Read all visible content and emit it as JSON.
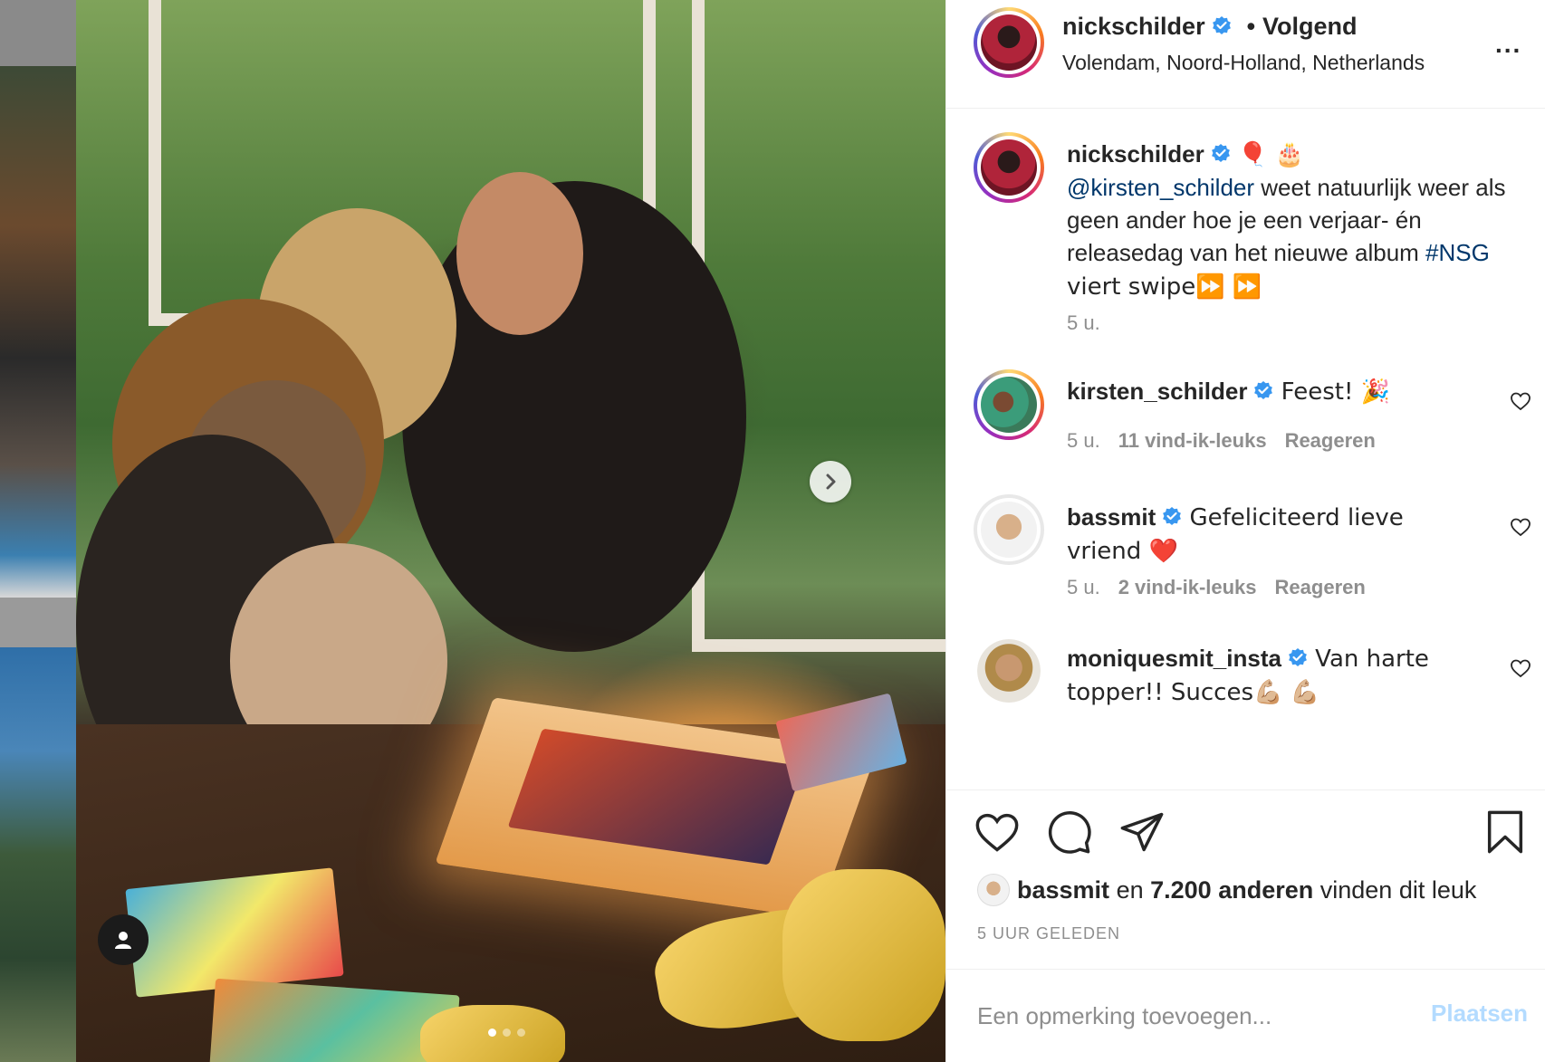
{
  "header": {
    "username": "nickschilder",
    "follow_separator": "•",
    "follow_label": "Volgend",
    "location": "Volendam, Noord-Holland, Netherlands",
    "more_label": "..."
  },
  "caption": {
    "username": "nickschilder",
    "emojis": "🎈 🎂",
    "mention": "@kirsten_schilder",
    "text": " weet natuurlijk weer als geen ander hoe je een verjaar- én releasedag van het nieuwe album ",
    "hashtag": "#NSG",
    "text_end": " viert swipe⏩ ⏩",
    "time": "5 u."
  },
  "comments": [
    {
      "username": "kirsten_schilder",
      "text": "Feest! 🎉",
      "time": "5 u.",
      "likes": "11 vind-ik-leuks",
      "reply": "Reageren"
    },
    {
      "username": "bassmit",
      "text": "Gefeliciteerd lieve vriend ❤️",
      "time": "5 u.",
      "likes": "2 vind-ik-leuks",
      "reply": "Reageren"
    },
    {
      "username": "moniquesmit_insta",
      "text": "Van harte topper!! Succes💪🏼 💪🏼"
    }
  ],
  "likes_bar": {
    "user": "bassmit",
    "connector": "en",
    "others": "7.200 anderen",
    "suffix": "vinden dit leuk"
  },
  "post_time": "5 UUR GELEDEN",
  "add_comment": {
    "placeholder": "Een opmerking toevoegen...",
    "post_label": "Plaatsen"
  },
  "carousel": {
    "slide_count": 3,
    "active_index": 0
  },
  "colors": {
    "verified": "#3897f0",
    "link": "#00376b",
    "muted": "#8e8e8e",
    "post_disabled": "#b3dbff"
  },
  "icons": {
    "verified": "verified-badge-icon",
    "more": "more-options-icon",
    "heart": "heart-icon",
    "comment": "comment-icon",
    "share": "share-icon",
    "save": "bookmark-icon",
    "next": "chevron-right-icon",
    "user_tag": "user-tag-icon"
  }
}
